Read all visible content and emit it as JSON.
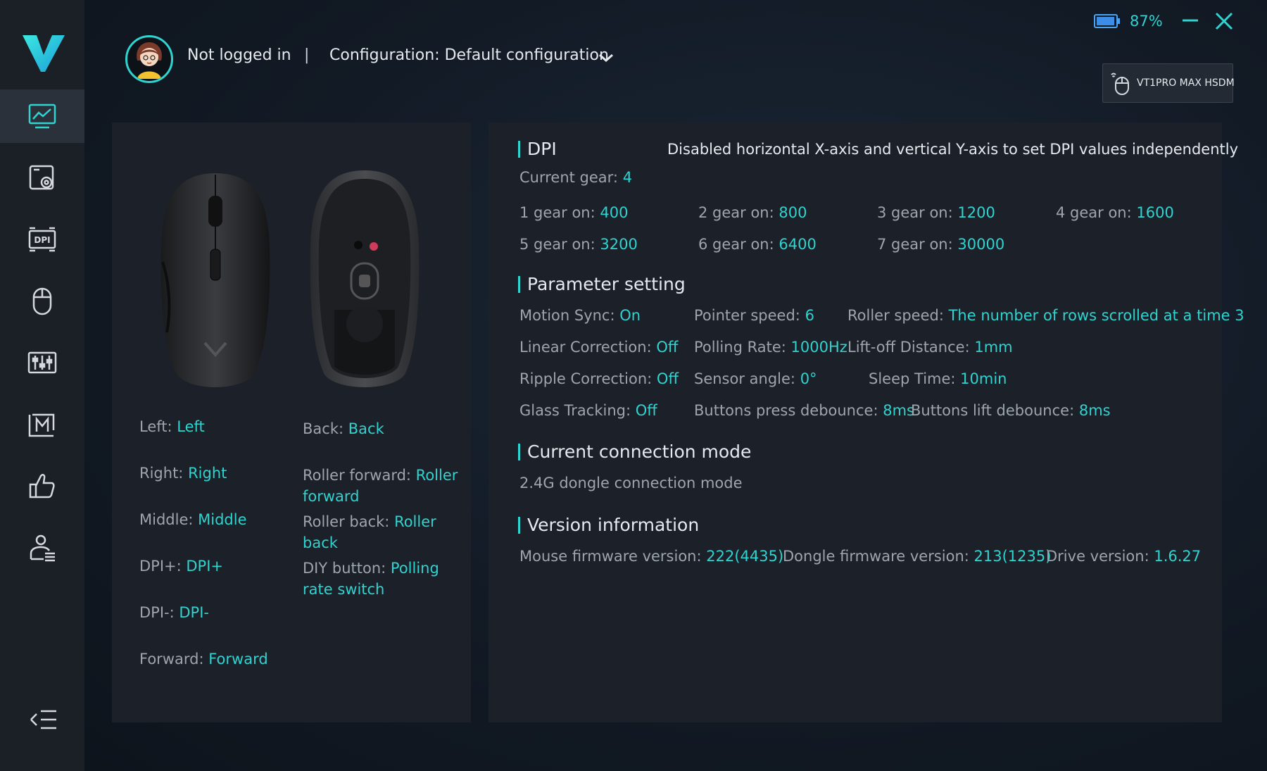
{
  "header": {
    "login_status": "Not logged in",
    "separator": "|",
    "config_label": "Configuration: Default configuration",
    "battery_pct": "87%",
    "device_name": "VT1PRO MAX HSDM"
  },
  "sidebar": {
    "items": [
      {
        "icon": "monitor-chart-icon",
        "active": true
      },
      {
        "icon": "screen-settings-icon",
        "active": false
      },
      {
        "icon": "dpi-icon",
        "active": false
      },
      {
        "icon": "mouse-icon",
        "active": false
      },
      {
        "icon": "equalizer-icon",
        "active": false
      },
      {
        "icon": "macro-icon",
        "active": false
      },
      {
        "icon": "thumbs-up-icon",
        "active": false
      },
      {
        "icon": "user-list-icon",
        "active": false
      }
    ]
  },
  "buttons": {
    "left_col": [
      {
        "label": "Left:",
        "value": "Left"
      },
      {
        "label": "Right:",
        "value": "Right"
      },
      {
        "label": "Middle:",
        "value": "Middle"
      },
      {
        "label": "DPI+:",
        "value": "DPI+"
      },
      {
        "label": "DPI-:",
        "value": "DPI-"
      },
      {
        "label": "Forward:",
        "value": "Forward"
      }
    ],
    "right_col": [
      {
        "label": "Back:",
        "value": "Back"
      },
      {
        "label": "Roller forward:",
        "value": "Roller forward"
      },
      {
        "label": "Roller back:",
        "value": "Roller back"
      },
      {
        "label": "DIY button:",
        "value": "Polling rate switch"
      }
    ]
  },
  "dpi": {
    "title": "DPI",
    "note": "Disabled horizontal X-axis and vertical Y-axis to set DPI values independently",
    "current_label": "Current gear:",
    "current_value": "4",
    "gears": [
      {
        "label": "1 gear on:",
        "value": "400"
      },
      {
        "label": "2 gear on:",
        "value": "800"
      },
      {
        "label": "3 gear on:",
        "value": "1200"
      },
      {
        "label": "4 gear on:",
        "value": "1600"
      },
      {
        "label": "5 gear on:",
        "value": "3200"
      },
      {
        "label": "6 gear on:",
        "value": "6400"
      },
      {
        "label": "7 gear on:",
        "value": "30000"
      }
    ]
  },
  "params": {
    "title": "Parameter setting",
    "items": [
      {
        "label": "Motion Sync:",
        "value": "On"
      },
      {
        "label": "Pointer speed:",
        "value": "6"
      },
      {
        "label": "Roller speed:",
        "value": "The number of rows scrolled at a time 3"
      },
      {
        "label": "Linear Correction:",
        "value": "Off"
      },
      {
        "label": "Polling Rate:",
        "value": "1000Hz"
      },
      {
        "label": "Lift-off Distance:",
        "value": "1mm"
      },
      {
        "label": "Ripple Correction:",
        "value": "Off"
      },
      {
        "label": "Sensor angle:",
        "value": "0°"
      },
      {
        "label": "Sleep Time:",
        "value": "10min"
      },
      {
        "label": "Glass Tracking:",
        "value": "Off"
      },
      {
        "label": "Buttons press debounce:",
        "value": "8ms"
      },
      {
        "label": "Buttons lift debounce:",
        "value": "8ms"
      }
    ]
  },
  "connection": {
    "title": "Current connection mode",
    "mode": "2.4G dongle connection mode"
  },
  "version": {
    "title": "Version information",
    "items": [
      {
        "label": "Mouse firmware version:",
        "value": "222(4435)"
      },
      {
        "label": "Dongle firmware version:",
        "value": "213(1235)"
      },
      {
        "label": "Drive version:",
        "value": "1.6.27"
      }
    ]
  },
  "colors": {
    "accent": "#2fd3d0",
    "sidebar_bg": "#1b1f26",
    "panel_bg": "#1c2028"
  }
}
